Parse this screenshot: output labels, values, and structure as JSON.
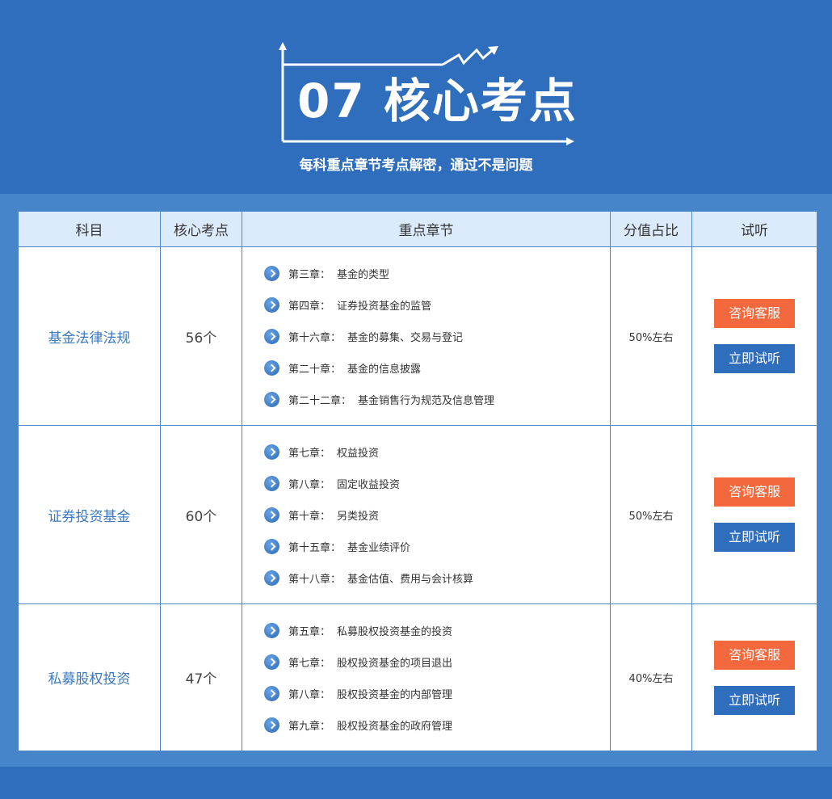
{
  "header": {
    "title": "07 核心考点",
    "subtitle": "每科重点章节考点解密，通过不是问题"
  },
  "table": {
    "columns": [
      "科目",
      "核心考点",
      "重点章节",
      "分值占比",
      "试听"
    ],
    "rows": [
      {
        "subject": "基金法律法规",
        "count": "56个",
        "ratio": "50%左右",
        "chapters": [
          {
            "ch": "第三章：",
            "name": "基金的类型"
          },
          {
            "ch": "第四章：",
            "name": "证券投资基金的监管"
          },
          {
            "ch": "第十六章：",
            "name": "基金的募集、交易与登记"
          },
          {
            "ch": "第二十章：",
            "name": "基金的信息披露"
          },
          {
            "ch": "第二十二章：",
            "name": "基金销售行为规范及信息管理"
          }
        ]
      },
      {
        "subject": "证券投资基金",
        "count": "60个",
        "ratio": "50%左右",
        "chapters": [
          {
            "ch": "第七章：",
            "name": "权益投资"
          },
          {
            "ch": "第八章：",
            "name": "固定收益投资"
          },
          {
            "ch": "第十章：",
            "name": "另类投资"
          },
          {
            "ch": "第十五章：",
            "name": "基金业绩评价"
          },
          {
            "ch": "第十八章：",
            "name": "基金估值、费用与会计核算"
          }
        ]
      },
      {
        "subject": "私募股权投资",
        "count": "47个",
        "ratio": "40%左右",
        "chapters": [
          {
            "ch": "第五章：",
            "name": "私募股权投资基金的投资"
          },
          {
            "ch": "第七章：",
            "name": "股权投资基金的项目退出"
          },
          {
            "ch": "第八章：",
            "name": "股权投资基金的内部管理"
          },
          {
            "ch": "第九章：",
            "name": "股权投资基金的政府管理"
          }
        ]
      }
    ],
    "buttons": {
      "consult": "咨询客服",
      "listen": "立即试听"
    }
  },
  "colors": {
    "background": "#2f6ebd",
    "panel": "#4785ca",
    "header_row": "#dcebfb",
    "consult_button": "#f4683e",
    "listen_button": "#2f6ebd",
    "subject_text": "#3a78c0"
  },
  "icons": {
    "chapter_bullet": "chevron-right-circle-icon",
    "title_frame": "rising-chart-arrow-icon"
  }
}
